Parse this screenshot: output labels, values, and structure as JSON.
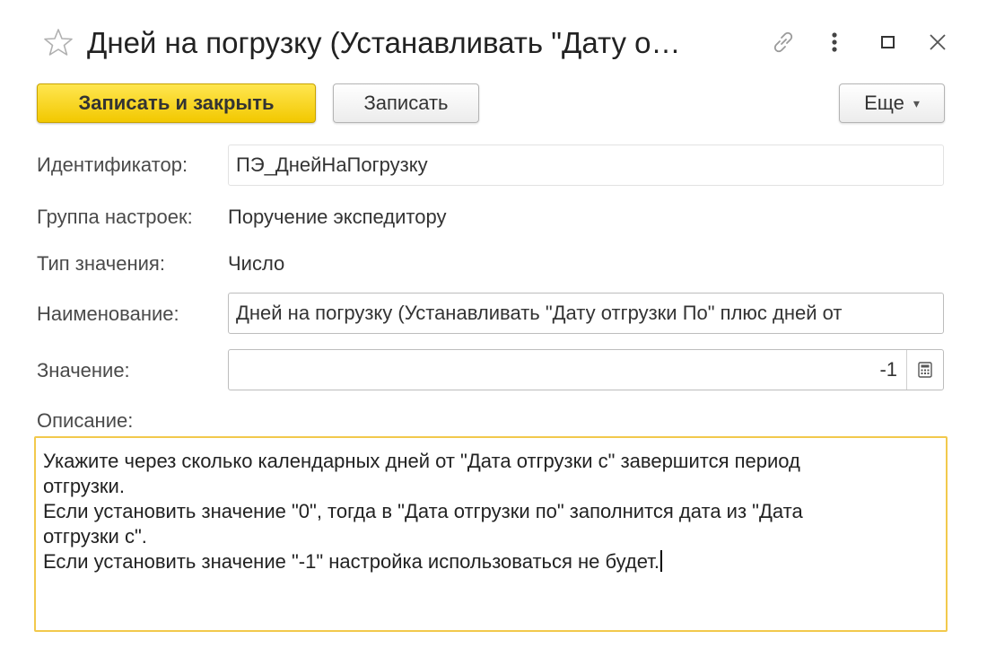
{
  "window": {
    "title": "Дней на погрузку (Устанавливать \"Дату о…",
    "icons": [
      "star-icon",
      "link-icon",
      "more-vertical-icon",
      "maximize-icon",
      "close-icon"
    ]
  },
  "toolbar": {
    "save_close_label": "Записать и закрыть",
    "save_label": "Записать",
    "more_label": "Еще"
  },
  "form": {
    "identifier_label": "Идентификатор:",
    "identifier_value": "ПЭ_ДнейНаПогрузку",
    "group_label": "Группа настроек:",
    "group_value": "Поручение экспедитору",
    "type_label": "Тип значения:",
    "type_value": "Число",
    "name_label": "Наименование:",
    "name_value": "Дней на погрузку (Устанавливать \"Дату отгрузки По\" плюс дней от",
    "value_label": "Значение:",
    "value_value": "-1",
    "description_label": "Описание:",
    "description_lines": [
      "Укажите через сколько календарных дней от \"Дата отгрузки с\" завершится период",
      "отгрузки.",
      "Если установить значение \"0\", тогда в \"Дата отгрузки по\" заполнится дата из \"Дата",
      "отгрузки с\".",
      "Если установить значение \"-1\" настройка использоваться не будет."
    ]
  },
  "colors": {
    "primary_button": "#f2c800",
    "focus_border": "#f2c94c"
  }
}
